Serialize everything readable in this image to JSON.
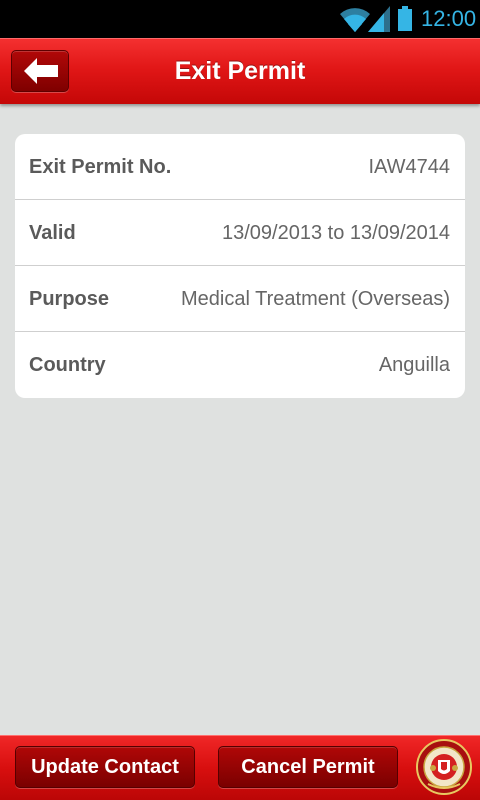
{
  "status_bar": {
    "time": "12:00",
    "icons": [
      "wifi-icon",
      "signal-icon",
      "battery-icon"
    ],
    "accent_color": "#35b5e5"
  },
  "header": {
    "title": "Exit Permit",
    "back_icon": "arrow-left-icon",
    "color": "#e11717"
  },
  "details": [
    {
      "label": "Exit Permit No.",
      "value": "IAW4744"
    },
    {
      "label": "Valid",
      "value": "13/09/2013 to 13/09/2014"
    },
    {
      "label": "Purpose",
      "value": "Medical Treatment (Overseas)"
    },
    {
      "label": "Country",
      "value": "Anguilla"
    }
  ],
  "footer": {
    "update_contact_label": "Update Contact",
    "cancel_permit_label": "Cancel Permit",
    "emblem_icon": "agency-crest-icon"
  }
}
